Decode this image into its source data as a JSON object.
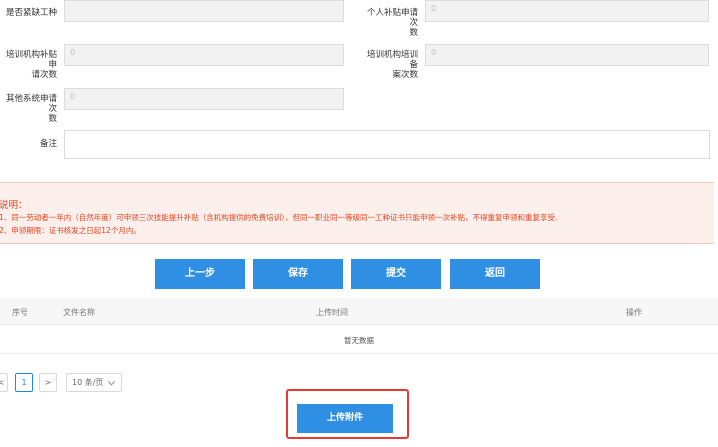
{
  "form": {
    "shortage": {
      "label": "是否紧缺工种",
      "value": ""
    },
    "personal_count": {
      "label_1": "个人补贴申请次",
      "label_2": "数",
      "value": "0"
    },
    "org_subsidy": {
      "label_1": "培训机构补贴申",
      "label_2": "请次数",
      "value": "0"
    },
    "org_record": {
      "label_1": "培训机构培训备",
      "label_2": "案次数",
      "value": "0"
    },
    "other_system": {
      "label_1": "其他系统申请次",
      "label_2": "数",
      "value": "0"
    },
    "remark": {
      "label": "备注",
      "value": ""
    }
  },
  "notice": {
    "title": "说明：",
    "line1": "1、同一劳动者一年内（自然年度）可申领三次技能提升补贴（含机构提供的免费培训），但同一职业同一等级同一工种证书只能申领一次补贴，不得重复申领和重复享受.",
    "line2": "2、申领期限：证书核发之日起12个月内。"
  },
  "actions": {
    "prev": "上一步",
    "save": "保存",
    "submit": "提交",
    "back": "返回"
  },
  "table": {
    "headers": {
      "index": "序号",
      "filename": "文件名称",
      "upload_time": "上传时间",
      "operation": "操作"
    },
    "empty": "暂无数据"
  },
  "pagination": {
    "prev": "<",
    "current": "1",
    "next": ">",
    "page_size": "10 条/页"
  },
  "upload": {
    "label": "上传附件"
  }
}
